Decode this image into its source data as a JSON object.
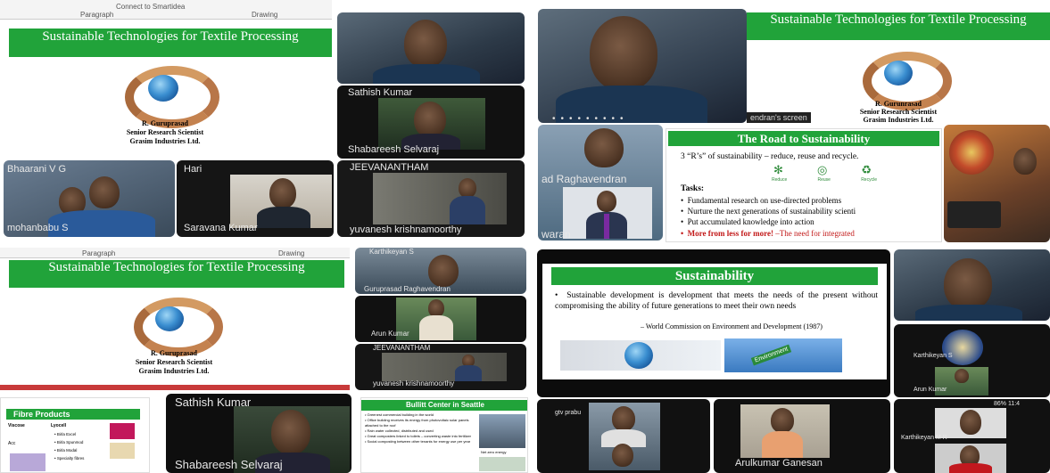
{
  "q1": {
    "ribbon": {
      "left": "Paragraph",
      "mid": "Connect to Smartidea",
      "right": "Drawing"
    },
    "slide": {
      "title": "Sustainable Technologies for Textile Processing",
      "author": "R. Guruprasad",
      "role": "Senior Research Scientist",
      "company": "Grasim Industries Ltd."
    },
    "tiles": {
      "sathish": "Sathish Kumar",
      "shabareesh": "Shabareesh Selvaraj",
      "bhaarani": "Bhaarani V G",
      "mohanbabu": "mohanbabu S",
      "hari": "Hari",
      "saravana": "Saravana Kumar",
      "jeevanantham": "JEEVANANTHAM",
      "yuvanesh": "yuvanesh krishnamoorthy"
    }
  },
  "q2": {
    "slide": {
      "title": "Sustainable Technologies for Textile Processing",
      "author": "R. Gurunrasad",
      "role": "Senior Research Scientist",
      "company": "Grasim Industries Ltd.",
      "screen_label": "endran's screen"
    },
    "road": {
      "title": "The Road to Sustainability",
      "intro": "3 “R’s” of sustainability – reduce, reuse and recycle.",
      "icon_labels": [
        "Reduce",
        "Reuse",
        "Recycle"
      ],
      "tasks_heading": "Tasks:",
      "tasks": [
        "Fundamental research on use-directed problems",
        "Nurture the next generations of sustainability scienti",
        "Put accumulated knowledge into action"
      ],
      "footer_red": "More from less for more!",
      "footer_rest": "–The need for integrated"
    },
    "tiles": {
      "raghavendran": "ad Raghavendran",
      "waran": "waran"
    }
  },
  "q3": {
    "ribbon": {
      "left": "Paragraph",
      "right": "Drawing"
    },
    "slide": {
      "title": "Sustainable Technologies for Textile Processing",
      "author": "R. Guruprasad",
      "role": "Senior Research Scientist",
      "company": "Grasim Industries Ltd."
    },
    "tiles": {
      "karthikeyan": "Karthikeyan S",
      "guruprasad": "Guruprasad Raghavendran",
      "arun": "Arun Kumar",
      "jeevanantham": "JEEVANANTHAM",
      "yuvanesh": "yuvanesh krishnamoorthy",
      "sathish": "Sathish Kumar",
      "shabareesh": "Shabareesh Selvaraj"
    },
    "fibre": {
      "title": "Fibre Products",
      "col1": "Viscose",
      "col2": "Lyocell",
      "items": [
        "Birla Excel",
        "Birla Spunmod",
        "Birla Modal",
        "Specialty fibres"
      ],
      "side_label": "Acc"
    },
    "bullitt": {
      "title": "Bullitt Center in Seattle",
      "bullets": [
        "Greenest commercial building in the world",
        "Office building receives its energy from photovoltaic solar panels attached to the roof",
        "Rain water collected, distributed and used",
        "Great composters linked to toilets – converting waste into fertilizer",
        "Social composting between other tenants for energy use per year"
      ],
      "side_label": "Net zero energy"
    }
  },
  "q4": {
    "slide": {
      "title": "Sustainability",
      "body": "Sustainable development is development that meets the needs of the present without compromising the ability of future generations to meet their own needs",
      "citation": "– World Commission on Environment and Development (1987)",
      "sign_text": "Environment"
    },
    "tiles": {
      "karthikeyan": "Karthikeyan S",
      "arun": "Arun Kumar",
      "gv": "gtv prabu",
      "arulkumar": "Arulkumar Ganesan",
      "karthikeyan_m": "Karthikeyan M R",
      "status": "86% 11:4"
    }
  }
}
